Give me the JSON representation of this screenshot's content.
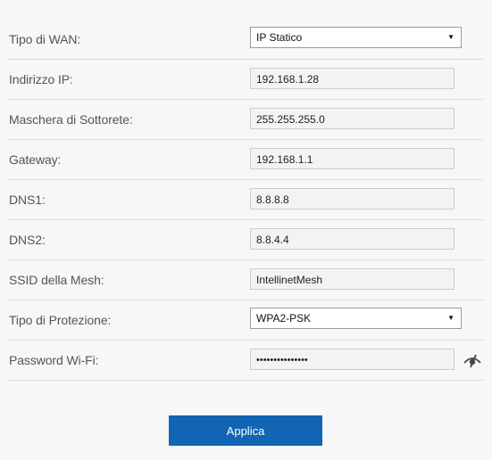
{
  "form": {
    "wan_type": {
      "label": "Tipo di WAN:",
      "value": "IP Statico"
    },
    "ip_address": {
      "label": "Indirizzo IP:",
      "value": "192.168.1.28"
    },
    "subnet_mask": {
      "label": "Maschera di Sottorete:",
      "value": "255.255.255.0"
    },
    "gateway": {
      "label": "Gateway:",
      "value": "192.168.1.1"
    },
    "dns1": {
      "label": "DNS1:",
      "value": "8.8.8.8"
    },
    "dns2": {
      "label": "DNS2:",
      "value": "8.8.4.4"
    },
    "mesh_ssid": {
      "label": "SSID della Mesh:",
      "value": "IntellinetMesh"
    },
    "security_type": {
      "label": "Tipo di Protezione:",
      "value": "WPA2-PSK"
    },
    "wifi_password": {
      "label": "Password Wi-Fi:",
      "value": "•••••••••••••••"
    }
  },
  "icons": {
    "dropdown": "chevron-down-icon",
    "password_toggle": "eye-slash-icon"
  },
  "buttons": {
    "apply_label": "Applica"
  },
  "colors": {
    "primary": "#1265b3",
    "background": "#f7f7f7"
  }
}
